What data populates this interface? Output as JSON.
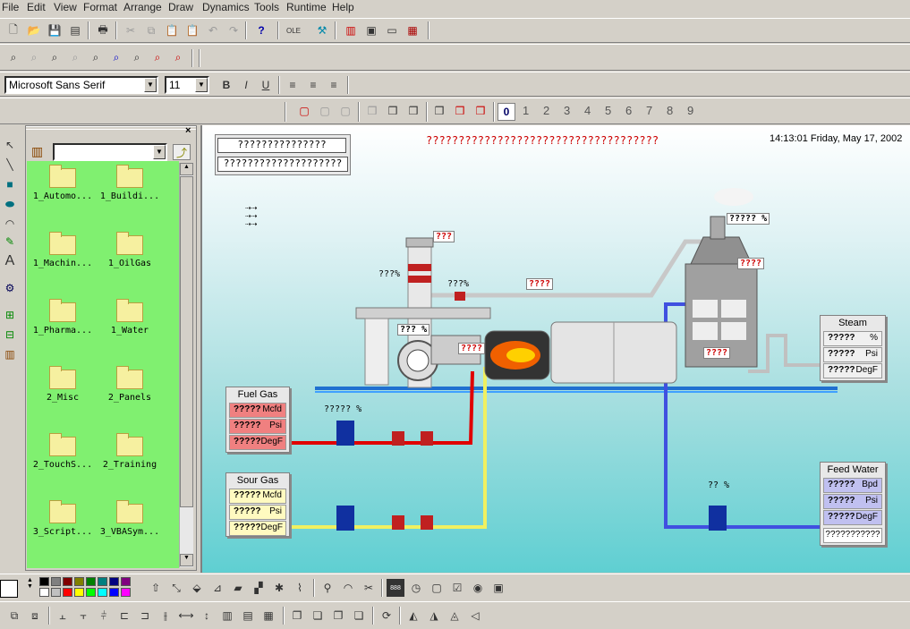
{
  "menu": [
    "File",
    "Edit",
    "View",
    "Format",
    "Arrange",
    "Draw",
    "Dynamics",
    "Tools",
    "Runtime",
    "Help"
  ],
  "font": {
    "name": "Microsoft Sans Serif",
    "size": "11",
    "bold": "B",
    "italic": "I",
    "underline": "U"
  },
  "layers": [
    "1",
    "2",
    "3",
    "4",
    "5",
    "6",
    "7",
    "8",
    "9"
  ],
  "layer_current": "0",
  "folders": [
    "1_Automo...",
    "1_Buildi...",
    "1_Machin...",
    "1_OilGas",
    "1_Pharma...",
    "1_Water",
    "2_Misc",
    "2_Panels",
    "2_TouchS...",
    "2_Training",
    "3_Script...",
    "3_VBASym..."
  ],
  "canvas": {
    "header_box1": "???????????????",
    "header_box2": "????????????????????",
    "title": "????????????????????????????????????",
    "datetime": "14:13:01 Friday, May 17, 2002",
    "tags": {
      "stack_top": "???",
      "stack_pct": "???%",
      "damper_pct": "???%",
      "pipe_temp": "????",
      "chimney_pct": "?????  %",
      "hood_temp": "????",
      "burner_pct": "???  %",
      "burner_temp": "????",
      "boiler_temp": "????",
      "gas_valve_pct": "?????  %",
      "water_valve_pct": "??  %"
    },
    "steam": {
      "title": "Steam",
      "rows": [
        {
          "v": "?????",
          "u": "%"
        },
        {
          "v": "?????",
          "u": "Psi"
        },
        {
          "v": "?????",
          "u": "DegF"
        }
      ]
    },
    "fuel_gas": {
      "title": "Fuel Gas",
      "rows": [
        {
          "v": "?????",
          "u": "Mcfd"
        },
        {
          "v": "?????",
          "u": "Psi"
        },
        {
          "v": "?????",
          "u": "DegF"
        }
      ]
    },
    "sour_gas": {
      "title": "Sour Gas",
      "rows": [
        {
          "v": "?????",
          "u": "Mcfd"
        },
        {
          "v": "?????",
          "u": "Psi"
        },
        {
          "v": "?????",
          "u": "DegF"
        }
      ]
    },
    "feed_water": {
      "title": "Feed Water",
      "rows": [
        {
          "v": "?????",
          "u": "Bpd"
        },
        {
          "v": "?????",
          "u": "Psi"
        },
        {
          "v": "?????",
          "u": "DegF"
        }
      ],
      "button": "???????????"
    }
  },
  "icons": [
    "new-icon",
    "open-icon",
    "save-icon",
    "print-icon",
    "cut-icon",
    "copy-icon",
    "paste-icon",
    "undo-icon",
    "redo-icon",
    "help-icon",
    "zoom-icon",
    "pointer-icon",
    "line-icon",
    "rect-icon",
    "ellipse-icon",
    "arc-icon",
    "text-icon",
    "folder-icon"
  ],
  "palette": [
    "#000000",
    "#808080",
    "#800000",
    "#808000",
    "#008000",
    "#008080",
    "#000080",
    "#800080",
    "#ffffff",
    "#c0c0c0",
    "#ff0000",
    "#ffff00",
    "#00ff00",
    "#00ffff",
    "#0000ff",
    "#ff00ff"
  ]
}
